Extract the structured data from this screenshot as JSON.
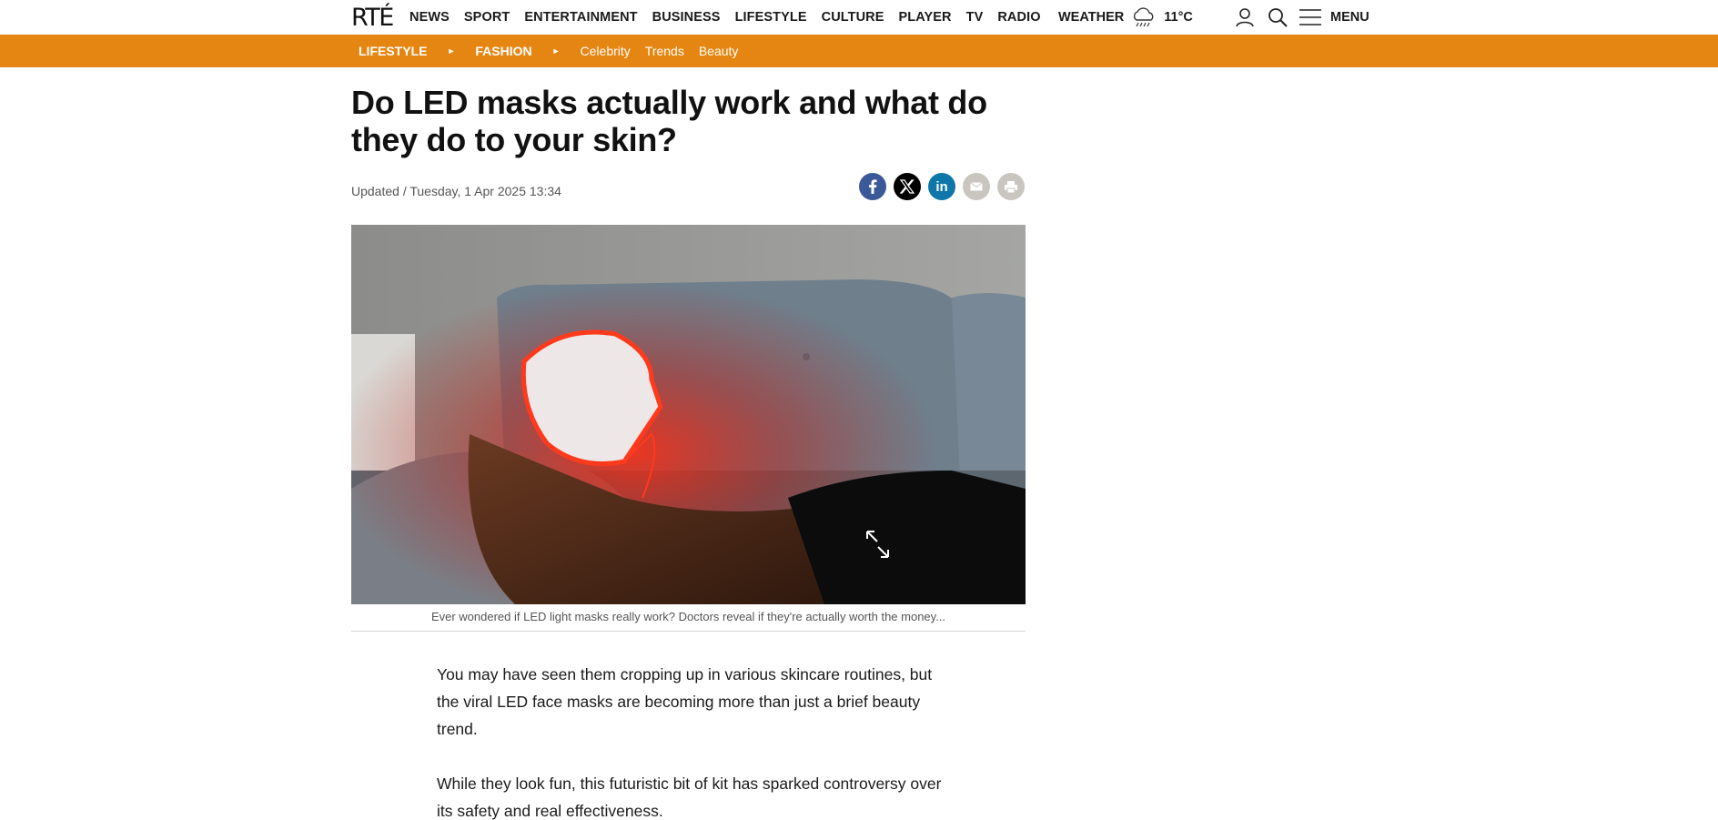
{
  "header": {
    "logo": "RTÉ",
    "nav": [
      "NEWS",
      "SPORT",
      "ENTERTAINMENT",
      "BUSINESS",
      "LIFESTYLE",
      "CULTURE",
      "PLAYER",
      "TV",
      "RADIO"
    ],
    "weather_label": "WEATHER",
    "weather_temp": "11°C",
    "weather_icon": "rain-cloud-icon",
    "menu_label": "MENU"
  },
  "section": {
    "primary": "LIFESTYLE",
    "secondary": "FASHION",
    "subs": [
      "Celebrity",
      "Trends",
      "Beauty"
    ],
    "accent": "#e68612"
  },
  "article": {
    "headline": "Do LED masks actually work and what do they do to your skin?",
    "updated": "Updated / Tuesday, 1 Apr 2025 13:34",
    "share": [
      {
        "name": "facebook-icon",
        "color": "#3b5998",
        "glyph": "f"
      },
      {
        "name": "x-icon",
        "color": "#000000",
        "glyph": "X"
      },
      {
        "name": "linkedin-icon",
        "color": "#0e76a8",
        "glyph": "in"
      },
      {
        "name": "email-icon",
        "color": "#c9c6c0",
        "glyph": "✉"
      },
      {
        "name": "print-icon",
        "color": "#c9c6c0",
        "glyph": "⎙"
      }
    ],
    "caption": "Ever wondered if LED light masks really work? Doctors reveal if they're actually worth the money...",
    "paragraphs": [
      "You may have seen them cropping up in various skincare routines, but the viral LED face masks are becoming more than just a brief beauty trend.",
      "While they look fun, this futuristic bit of kit has sparked controversy over its safety and real effectiveness."
    ]
  }
}
